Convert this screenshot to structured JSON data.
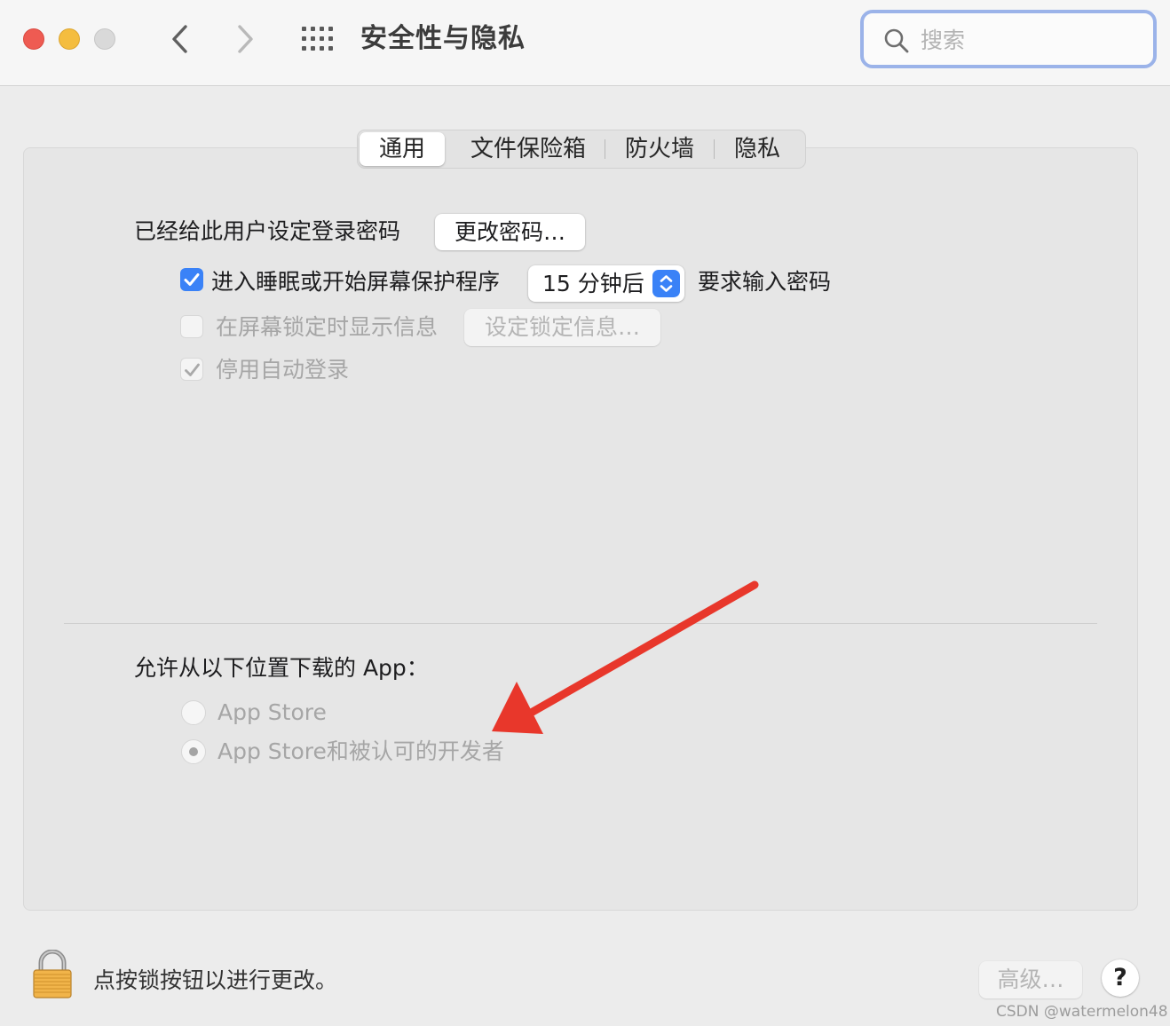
{
  "window": {
    "title": "安全性与隐私"
  },
  "search": {
    "placeholder": "搜索"
  },
  "tabs": [
    {
      "label": "通用",
      "selected": true
    },
    {
      "label": "文件保险箱",
      "selected": false
    },
    {
      "label": "防火墙",
      "selected": false
    },
    {
      "label": "隐私",
      "selected": false
    }
  ],
  "general": {
    "password_label": "已经给此用户设定登录密码",
    "change_password_button": "更改密码…",
    "require_password": {
      "checked": true,
      "label": "进入睡眠或开始屏幕保护程序",
      "delay_value": "15 分钟后",
      "suffix": "要求输入密码"
    },
    "show_message": {
      "checked": false,
      "enabled": false,
      "label": "在屏幕锁定时显示信息",
      "button": "设定锁定信息…"
    },
    "disable_autologin": {
      "checked": true,
      "enabled": false,
      "label": "停用自动登录"
    }
  },
  "allow_apps": {
    "label": "允许从以下位置下载的 App：",
    "options": [
      {
        "label": "App Store",
        "selected": false
      },
      {
        "label": "App Store和被认可的开发者",
        "selected": true
      }
    ]
  },
  "footer": {
    "lock_text": "点按锁按钮以进行更改。",
    "advanced_button": "高级…",
    "help_button": "?"
  },
  "watermark": "CSDN @watermelon48",
  "colors": {
    "accent": "#3a82f7",
    "close": "#ee5b52",
    "minimize": "#f4bd3f",
    "zoom": "#d9d9d9",
    "annotation_arrow": "#e8372b"
  }
}
